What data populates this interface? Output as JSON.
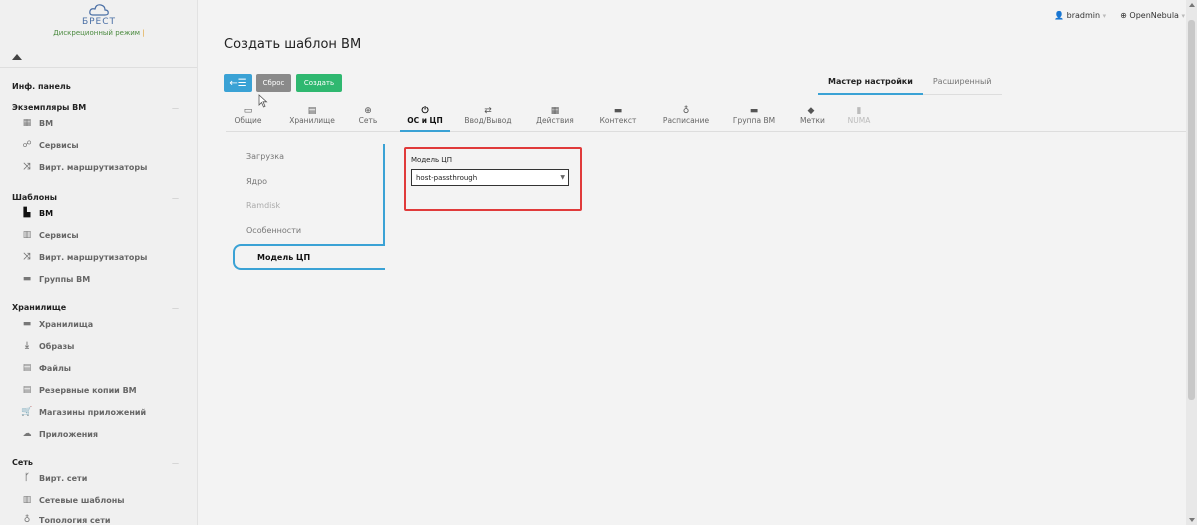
{
  "logo": {
    "text": "БРЕСТ",
    "mode": "Дискреционный режим",
    "mode_sep": "|"
  },
  "sidebar": {
    "dashboard": "Инф. панель",
    "sections": [
      {
        "title": "Экземпляры ВМ",
        "items": [
          {
            "label": "ВМ",
            "icon": "grid-icon"
          },
          {
            "label": "Сервисы",
            "icon": "services-icon"
          },
          {
            "label": "Вирт. маршрутизаторы",
            "icon": "shuffle-icon"
          }
        ]
      },
      {
        "title": "Шаблоны",
        "items": [
          {
            "label": "ВМ",
            "icon": "file-icon",
            "active": true
          },
          {
            "label": "Сервисы",
            "icon": "copy-icon"
          },
          {
            "label": "Вирт. маршрутизаторы",
            "icon": "shuffle-icon"
          },
          {
            "label": "Группы ВМ",
            "icon": "folder-icon"
          }
        ]
      },
      {
        "title": "Хранилище",
        "items": [
          {
            "label": "Хранилища",
            "icon": "folder-icon"
          },
          {
            "label": "Образы",
            "icon": "download-icon"
          },
          {
            "label": "Файлы",
            "icon": "archive-icon"
          },
          {
            "label": "Резервные копии ВМ",
            "icon": "archive-icon"
          },
          {
            "label": "Магазины приложений",
            "icon": "cart-icon"
          },
          {
            "label": "Приложения",
            "icon": "cloud-icon"
          }
        ]
      },
      {
        "title": "Сеть",
        "items": [
          {
            "label": "Вирт. сети",
            "icon": "network-icon"
          },
          {
            "label": "Сетевые шаблоны",
            "icon": "copy-icon"
          },
          {
            "label": "Топология сети",
            "icon": "sitemap-icon"
          }
        ]
      }
    ]
  },
  "topbar": {
    "user": "bradmin",
    "zone": "OpenNebula"
  },
  "page_title": "Создать шаблон ВМ",
  "buttons": {
    "back": "←☰",
    "reset": "Сброс",
    "create": "Создать"
  },
  "wizard": {
    "basic": "Мастер настройки",
    "advanced": "Расширенный"
  },
  "tabs": [
    {
      "label": "Общие",
      "icon": "laptop-icon"
    },
    {
      "label": "Хранилище",
      "icon": "hdd-icon"
    },
    {
      "label": "Сеть",
      "icon": "globe-icon"
    },
    {
      "label": "ОС и ЦП",
      "icon": "power-icon",
      "active": true
    },
    {
      "label": "Ввод/Вывод",
      "icon": "exchange-icon"
    },
    {
      "label": "Действия",
      "icon": "calendar-icon"
    },
    {
      "label": "Контекст",
      "icon": "folder-icon"
    },
    {
      "label": "Расписание",
      "icon": "sitemap-icon"
    },
    {
      "label": "Группа ВМ",
      "icon": "folder-icon"
    },
    {
      "label": "Метки",
      "icon": "tag-icon"
    },
    {
      "label": "NUMA",
      "icon": "chip-icon",
      "disabled": true
    }
  ],
  "subnav": {
    "items": [
      "Загрузка",
      "Ядро",
      "Ramdisk",
      "Особенности"
    ],
    "active": "Модель ЦП"
  },
  "cpu_model": {
    "label": "Модель ЦП",
    "value": "host-passthrough"
  }
}
